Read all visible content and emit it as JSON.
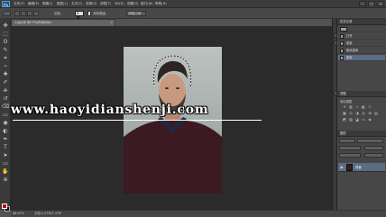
{
  "app": {
    "logo": "Ps"
  },
  "menu": [
    "文件(F)",
    "编辑(E)",
    "图像(I)",
    "图层(L)",
    "文字(Y)",
    "选择(S)",
    "滤镜(T)",
    "3D(D)",
    "视图(V)",
    "窗口(W)",
    "帮助(H)"
  ],
  "window_buttons": [
    "–",
    "□",
    "×"
  ],
  "options": {
    "feather_label": "羽化:",
    "feather_value": "0 像素",
    "antialias_label": "消除锯齿",
    "refine_label": "调整边缘..."
  },
  "document_tab": {
    "title": "1.jpg @ 66.7%(RGB/8#)",
    "close": "×"
  },
  "watermark": "www.haoyidianshenji.com",
  "status": {
    "zoom": "66.67%",
    "doc_size": "文档:1.37M/1.37M"
  },
  "history": {
    "header": "历史记录",
    "items": [
      {
        "label": "打开",
        "active": false
      },
      {
        "label": "套索",
        "active": false
      },
      {
        "label": "取消选择",
        "active": false
      },
      {
        "label": "套索",
        "active": true
      }
    ]
  },
  "adjustments": {
    "header": "调整",
    "subtitle": "添加调整"
  },
  "layers": {
    "header": "图层",
    "row": {
      "name": "背景"
    }
  },
  "icons": {
    "tools": [
      "move-icon",
      "marquee-icon",
      "lasso-icon",
      "quick-select-icon",
      "crop-icon",
      "eyedropper-icon",
      "healing-brush-icon",
      "brush-icon",
      "clone-stamp-icon",
      "history-brush-icon",
      "eraser-icon",
      "gradient-icon",
      "blur-icon",
      "dodge-icon",
      "pen-icon",
      "type-icon",
      "path-select-icon",
      "shape-icon",
      "hand-icon",
      "zoom-icon"
    ],
    "tool_glyphs": [
      "✥",
      "⬚",
      "ʘ",
      "✎",
      "⌗",
      "⌁",
      "✚",
      "✐",
      "⎈",
      "↺",
      "⌫",
      "▭",
      "◉",
      "◐",
      "✒",
      "T",
      "➤",
      "▭",
      "✋",
      "⊕"
    ]
  },
  "colors": {
    "foreground": "#c0001a",
    "background": "#111111",
    "selection_accent": "#5a6d84"
  }
}
